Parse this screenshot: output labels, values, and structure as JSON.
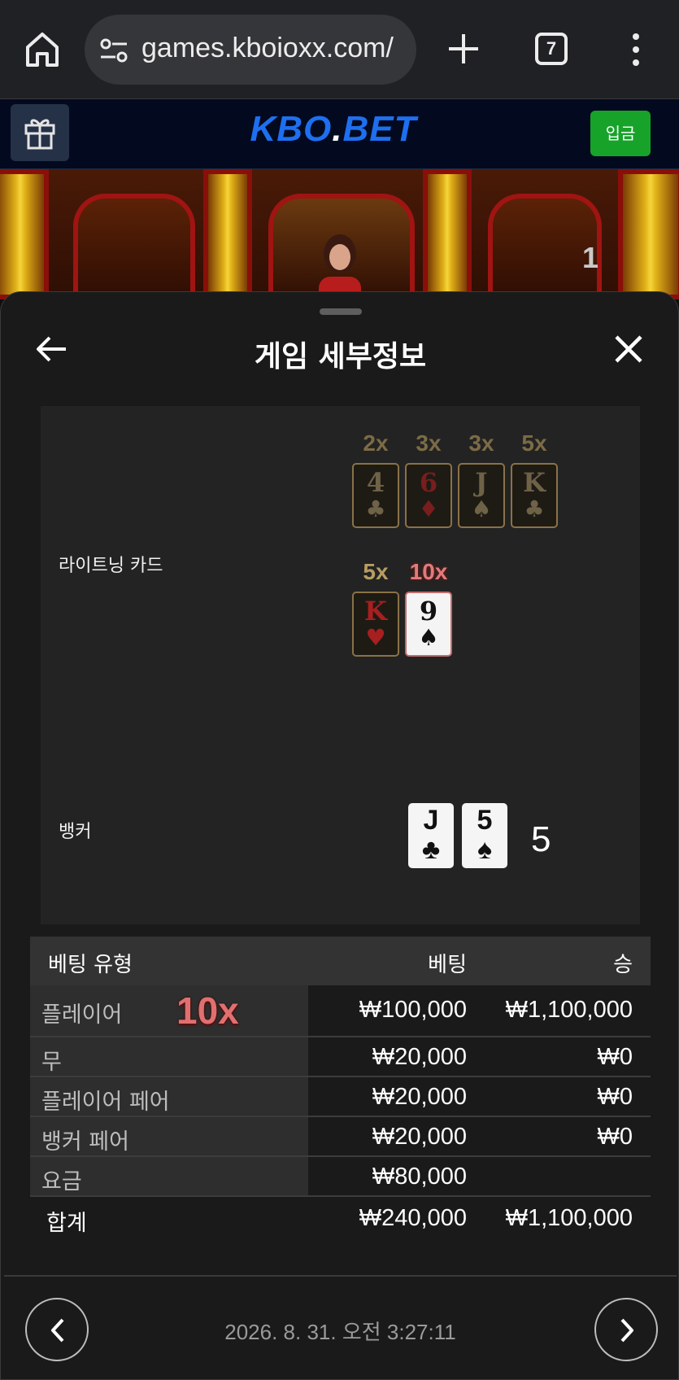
{
  "browser": {
    "url": "games.kboioxx.com/",
    "tab_count": "7"
  },
  "site_header": {
    "logo_text": "KBO",
    "logo_dot": ".",
    "logo_text2": "BET",
    "deposit_label": "입금"
  },
  "video": {
    "counter": "1"
  },
  "sheet": {
    "title": "게임 세부정보",
    "lightning_label": "라이트닝 카드",
    "banker_label": "뱅커",
    "lightning_cards_row1": [
      {
        "mult": "2x",
        "rank": "4",
        "suit": "♣",
        "color": "dim-black"
      },
      {
        "mult": "3x",
        "rank": "6",
        "suit": "♦",
        "color": "dim-red"
      },
      {
        "mult": "3x",
        "rank": "J",
        "suit": "♠",
        "color": "dim-black"
      },
      {
        "mult": "5x",
        "rank": "K",
        "suit": "♣",
        "color": "dim-black"
      }
    ],
    "lightning_cards_row2": [
      {
        "mult": "5x",
        "rank": "K",
        "suit": "♥",
        "color": "red-lit"
      },
      {
        "mult": "10x",
        "rank": "9",
        "suit": "♠",
        "color": "white"
      }
    ],
    "banker_cards": [
      {
        "rank": "J",
        "suit": "♣"
      },
      {
        "rank": "5",
        "suit": "♠"
      }
    ],
    "banker_score": "5"
  },
  "bets_table": {
    "headers": {
      "type": "베팅 유형",
      "bet": "베팅",
      "win": "승"
    },
    "rows": [
      {
        "type": "플레이어",
        "multiplier": "10x",
        "bet": "₩100,000",
        "win": "₩1,100,000"
      },
      {
        "type": "무",
        "bet": "₩20,000",
        "win": "₩0"
      },
      {
        "type": "플레이어 페어",
        "bet": "₩20,000",
        "win": "₩0"
      },
      {
        "type": "뱅커 페어",
        "bet": "₩20,000",
        "win": "₩0"
      },
      {
        "type": "요금",
        "bet": "₩80,000",
        "win": ""
      }
    ],
    "total": {
      "label": "합계",
      "bet": "₩240,000",
      "win": "₩1,100,000"
    }
  },
  "footer": {
    "timestamp": "2026. 8. 31. 오전 3:27:11"
  }
}
